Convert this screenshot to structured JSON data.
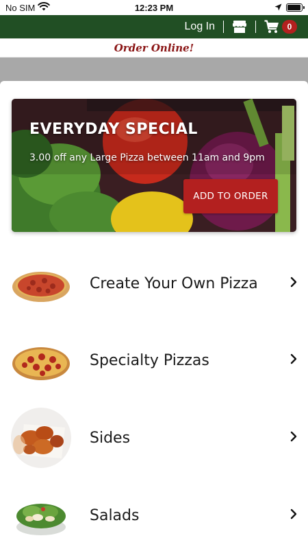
{
  "status_bar": {
    "carrier": "No SIM",
    "time": "12:23 PM",
    "battery_level": 0.95
  },
  "header": {
    "login_label": "Log In",
    "cart_count": "0",
    "store_icon": "store-icon",
    "cart_icon": "cart-icon",
    "color": "#214f24"
  },
  "banner": {
    "text": "Order Online!",
    "color": "#8a1414"
  },
  "special": {
    "title": "EVERYDAY SPECIAL",
    "description": "3.00 off any Large Pizza between 11am and 9pm",
    "button_label": "ADD TO ORDER",
    "button_color": "#b3201f"
  },
  "menu": {
    "items": [
      {
        "label": "Create Your Own Pizza",
        "icon": "cheese-pizza-image"
      },
      {
        "label": "Specialty Pizzas",
        "icon": "pepperoni-pizza-image"
      },
      {
        "label": "Sides",
        "icon": "wings-image"
      },
      {
        "label": "Salads",
        "icon": "salad-image"
      }
    ]
  }
}
